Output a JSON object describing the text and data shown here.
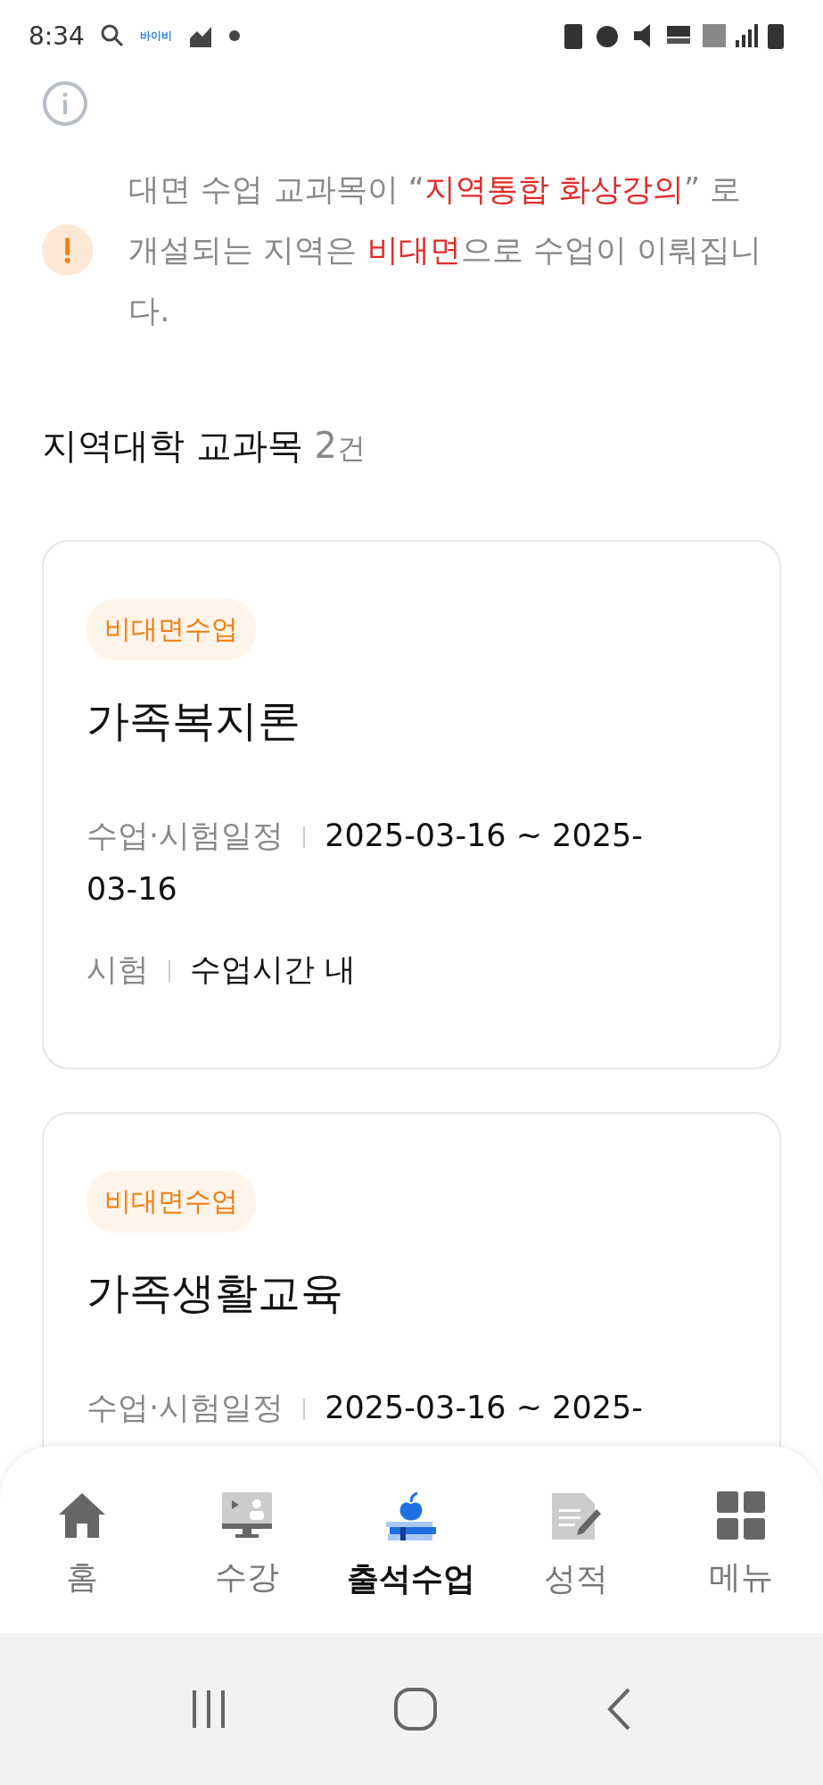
{
  "status_bar": {
    "time": "8:34",
    "app_label": "바이비"
  },
  "notices": [
    {
      "kind": "info"
    },
    {
      "kind": "warning",
      "segments": [
        {
          "text": "대면 수업 교과목이 “",
          "highlight": false
        },
        {
          "text": "지역통합 화상강의",
          "highlight": true
        },
        {
          "text": "” 로 개설되는 지역은 ",
          "highlight": false
        },
        {
          "text": "비대면",
          "highlight": true
        },
        {
          "text": "으로 수업이 이뤄집니다.",
          "highlight": false
        }
      ]
    }
  ],
  "section": {
    "title": "지역대학 교과목",
    "count": "2",
    "unit": "건"
  },
  "courses": [
    {
      "badge": "비대면수업",
      "title": "가족복지론",
      "rows": [
        {
          "label": "수업·시험일정",
          "value": "2025-03-16 ~ 2025-03-16"
        },
        {
          "label": "시험",
          "value": "수업시간 내"
        }
      ]
    },
    {
      "badge": "비대면수업",
      "title": "가족생활교육",
      "rows": [
        {
          "label": "수업·시험일정",
          "value": "2025-03-16 ~ 2025-"
        }
      ]
    }
  ],
  "bottom_nav": [
    {
      "label": "홈",
      "selected": false
    },
    {
      "label": "수강",
      "selected": false
    },
    {
      "label": "출석수업",
      "selected": true
    },
    {
      "label": "성적",
      "selected": false
    },
    {
      "label": "메뉴",
      "selected": false
    }
  ]
}
